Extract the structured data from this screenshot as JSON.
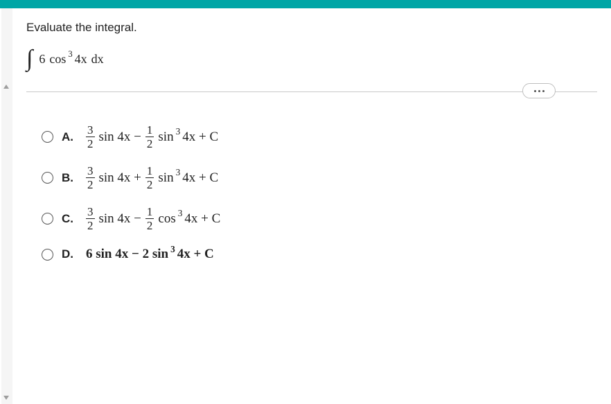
{
  "prompt": "Evaluate the integral.",
  "integral": {
    "coef": "6",
    "fn": "cos",
    "exp": "3",
    "arg": "4x",
    "dx": "dx"
  },
  "choices": {
    "a": {
      "letter": "A.",
      "f1n": "3",
      "f1d": "2",
      "t1": "sin 4x −",
      "f2n": "1",
      "f2d": "2",
      "t2a": "sin",
      "t2exp": "3",
      "t2b": "4x + C"
    },
    "b": {
      "letter": "B.",
      "f1n": "3",
      "f1d": "2",
      "t1": "sin 4x +",
      "f2n": "1",
      "f2d": "2",
      "t2a": "sin",
      "t2exp": "3",
      "t2b": "4x + C"
    },
    "c": {
      "letter": "C.",
      "f1n": "3",
      "f1d": "2",
      "t1": "sin 4x −",
      "f2n": "1",
      "f2d": "2",
      "t2a": "cos",
      "t2exp": "3",
      "t2b": "4x + C"
    },
    "d": {
      "letter": "D.",
      "text_a": "6 sin 4x − 2 sin",
      "exp": "3",
      "text_b": "4x + C"
    }
  }
}
